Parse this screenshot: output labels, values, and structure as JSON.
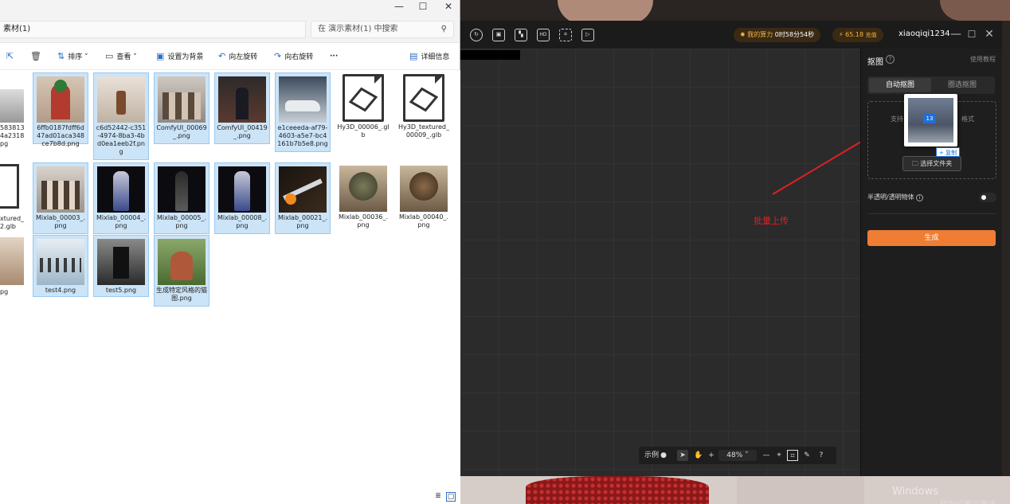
{
  "explorer": {
    "window_controls": {
      "minimize": "—",
      "maximize": "☐",
      "close": "✕"
    },
    "path": "素材(1)",
    "search_placeholder": "在 演示素材(1) 中搜索",
    "toolbar": {
      "sort": "排序",
      "view": "查看",
      "set_background": "设置为背景",
      "rotate_left": "向左旋转",
      "rotate_right": "向右旋转",
      "more": "···",
      "details": "详细信息"
    },
    "left_partial_labels": [
      "583813",
      "4a2318",
      "pg",
      "xtured_",
      "2.glb",
      "pg"
    ],
    "items": [
      {
        "label": "6ffb0187fdff6d47ad01aca348ce7b8d.png",
        "selected": true
      },
      {
        "label": "c6d52442-c351-4974-8ba3-4bd0ea1eeb2f.png",
        "selected": true
      },
      {
        "label": "ComfyUI_00069_.png",
        "selected": true
      },
      {
        "label": "ComfyUI_00419_.png",
        "selected": true
      },
      {
        "label": "e1ceeeda-af79-4603-a5e7-bc4161b7b5e8.png",
        "selected": true
      },
      {
        "label": "Hy3D_00006_.glb",
        "selected": false
      },
      {
        "label": "Hy3D_textured_00009_.glb",
        "selected": false
      },
      {
        "label": "Mixlab_00003_.png",
        "selected": true
      },
      {
        "label": "Mixlab_00004_.png",
        "selected": true
      },
      {
        "label": "Mixlab_00005_.png",
        "selected": true
      },
      {
        "label": "Mixlab_00008_.png",
        "selected": true
      },
      {
        "label": "Mixlab_00021_.png",
        "selected": true
      },
      {
        "label": "Mixlab_00036_.png",
        "selected": false
      },
      {
        "label": "Mixlab_00040_.png",
        "selected": false
      },
      {
        "label": "test4.png",
        "selected": true
      },
      {
        "label": "test5.png",
        "selected": true
      },
      {
        "label": "生成特定风格的猫图.png",
        "selected": true
      }
    ]
  },
  "app": {
    "compute_label": "我的算力",
    "compute_value": "0时58分54秒",
    "credits": "65.18",
    "recharge": "充值",
    "username": "xiaoqiqi1234",
    "panel": {
      "title": "抠图",
      "tutorial": "使用教程",
      "tab_auto": "自动抠图",
      "tab_select": "圈选抠图",
      "hint_left": "支持",
      "hint_right": "格式",
      "choose_folder": "选择文件夹",
      "drag_count": "13",
      "copy_tag": "+ 复制",
      "transparent_label": "半透明/透明物体",
      "generate": "生成"
    },
    "canvas_annotation": "批量上传",
    "zoombar": {
      "example": "示例",
      "zoom": "48%",
      "help": "?"
    }
  },
  "desktop": {
    "watermark": "Windows",
    "watermark_sub": "转到设置以激活 Windows"
  },
  "colors": {
    "accent_orange": "#ef7d34",
    "select_blue": "#cce4f7",
    "annotation_red": "#e02020"
  },
  "icons": [
    "minimize-icon",
    "maximize-icon",
    "close-icon",
    "search-icon",
    "share-icon",
    "delete-icon",
    "sort-icon",
    "view-icon",
    "background-icon",
    "rotate-left-icon",
    "rotate-right-icon",
    "details-icon",
    "help-icon",
    "folder-icon",
    "cursor-icon",
    "hand-icon",
    "zoom-in-icon",
    "zoom-out-icon",
    "target-icon",
    "crop-icon",
    "brush-icon"
  ]
}
